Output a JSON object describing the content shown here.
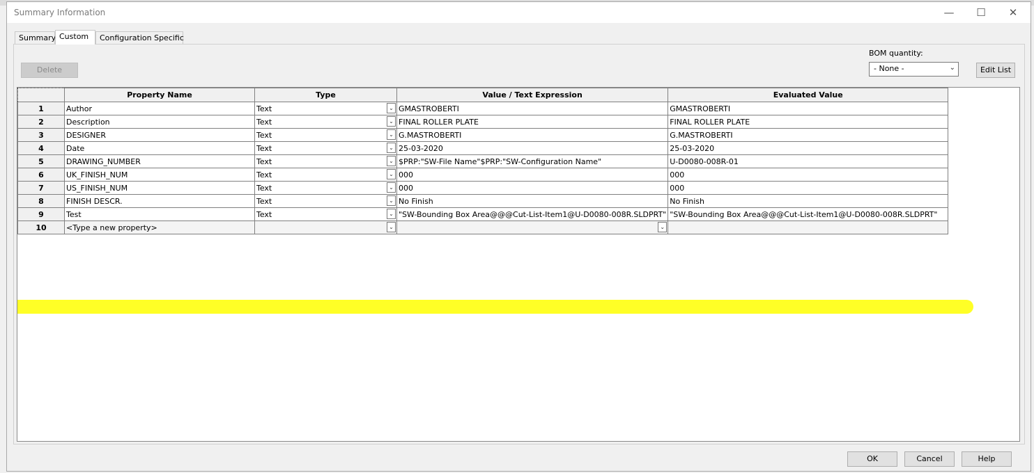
{
  "window": {
    "title": "Summary Information",
    "minimize_glyph": "—",
    "maximize_glyph": "☐",
    "close_glyph": "✕"
  },
  "tabs": [
    {
      "label": "Summary",
      "active": false
    },
    {
      "label": "Custom",
      "active": true
    },
    {
      "label": "Configuration Specific",
      "active": false
    }
  ],
  "toolbar": {
    "delete_label": "Delete",
    "bom_quantity_label": "BOM quantity:",
    "bom_quantity_value": "- None -",
    "edit_list_label": "Edit List"
  },
  "grid": {
    "columns": [
      "Property Name",
      "Type",
      "Value / Text Expression",
      "Evaluated Value"
    ],
    "rows": [
      {
        "num": "1",
        "name": "Author",
        "type": "Text",
        "value": "GMASTROBERTI",
        "evaluated": "GMASTROBERTI"
      },
      {
        "num": "2",
        "name": "Description",
        "type": "Text",
        "value": "FINAL ROLLER PLATE",
        "evaluated": "FINAL ROLLER PLATE"
      },
      {
        "num": "3",
        "name": "DESIGNER",
        "type": "Text",
        "value": "G.MASTROBERTI",
        "evaluated": "G.MASTROBERTI"
      },
      {
        "num": "4",
        "name": "Date",
        "type": "Text",
        "value": "25-03-2020",
        "evaluated": "25-03-2020"
      },
      {
        "num": "5",
        "name": "DRAWING_NUMBER",
        "type": "Text",
        "value": "$PRP:\"SW-File Name\"$PRP:\"SW-Configuration Name\"",
        "evaluated": "U-D0080-008R-01"
      },
      {
        "num": "6",
        "name": "UK_FINISH_NUM",
        "type": "Text",
        "value": "000",
        "evaluated": "000"
      },
      {
        "num": "7",
        "name": "US_FINISH_NUM",
        "type": "Text",
        "value": "000",
        "evaluated": "000"
      },
      {
        "num": "8",
        "name": "FINISH DESCR.",
        "type": "Text",
        "value": "No Finish",
        "evaluated": "No Finish"
      },
      {
        "num": "9",
        "name": "Test",
        "type": "Text",
        "value": "\"SW-Bounding Box Area@@@Cut-List-Item1@U-D0080-008R.SLDPRT\"",
        "evaluated": "\"SW-Bounding Box Area@@@Cut-List-Item1@U-D0080-008R.SLDPRT\""
      }
    ],
    "new_row": {
      "num": "10",
      "placeholder": "<Type a new property>"
    },
    "highlight_color": "#ffff00"
  },
  "footer": {
    "ok_label": "OK",
    "cancel_label": "Cancel",
    "help_label": "Help"
  },
  "icons": {
    "dropdown": "chevron-down-icon"
  }
}
